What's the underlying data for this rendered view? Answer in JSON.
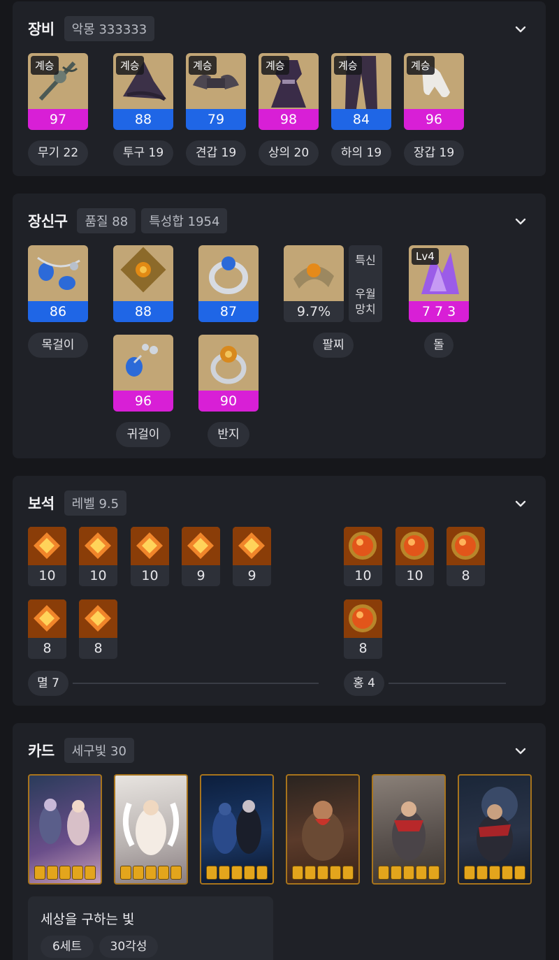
{
  "equipment": {
    "title": "장비",
    "badge": "악몽 333333",
    "tag": "계승",
    "items": [
      {
        "quality": "97",
        "tier": "pink",
        "label": "무기 22"
      },
      {
        "quality": "88",
        "tier": "blue",
        "label": "투구 19"
      },
      {
        "quality": "79",
        "tier": "blue",
        "label": "견갑 19"
      },
      {
        "quality": "98",
        "tier": "pink",
        "label": "상의 20"
      },
      {
        "quality": "84",
        "tier": "blue",
        "label": "하의 19"
      },
      {
        "quality": "96",
        "tier": "pink",
        "label": "장갑 19"
      }
    ]
  },
  "accessories": {
    "title": "장신구",
    "badge_quality": "품질 88",
    "badge_stats": "특성합 1954",
    "necklace": {
      "quality": "86",
      "label": "목걸이"
    },
    "earring1": {
      "quality": "88"
    },
    "earring2": {
      "quality": "96"
    },
    "earring_label": "귀걸이",
    "ring1": {
      "quality": "87"
    },
    "ring2": {
      "quality": "90"
    },
    "ring_label": "반지",
    "bracelet": {
      "value": "9.7%",
      "stat1": "특신",
      "stat2a": "우월",
      "stat2b": "망치",
      "label": "팔찌"
    },
    "stone": {
      "level": "Lv4",
      "value": "7 7 3",
      "label": "돌"
    }
  },
  "gems": {
    "title": "보석",
    "badge": "레벨 9.5",
    "annihilation": {
      "levels": [
        "10",
        "10",
        "10",
        "9",
        "9",
        "8",
        "8"
      ],
      "label": "멸 7"
    },
    "crimson": {
      "levels": [
        "10",
        "10",
        "8",
        "8"
      ],
      "label": "홍 4"
    }
  },
  "cards": {
    "title": "카드",
    "badge": "세구빛 30",
    "count": 6,
    "set_title": "세상을 구하는 빛",
    "set_count": "6세트",
    "awakening": "30각성"
  },
  "colors": {
    "pink": "#d81fd6",
    "blue": "#1f66e6",
    "panel": "#1f2127",
    "bg": "#16171b"
  }
}
